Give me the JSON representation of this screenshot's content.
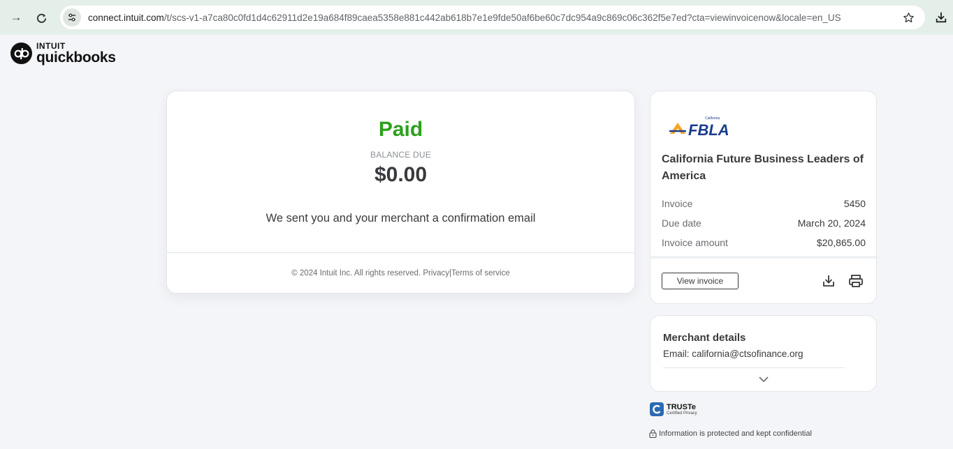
{
  "browser": {
    "url_host": "connect.intuit.com",
    "url_rest": "/t/scs-v1-a7ca80c0fd1d4c62911d2e19a684f89caea5358e881c442ab618b7e1e9fde50af6be60c7dc954a9c869c06c362f5e7ed?cta=viewinvoicenow&locale=en_US"
  },
  "logo": {
    "brand": "INTUIT",
    "product": "quickbooks"
  },
  "status": {
    "title": "Paid",
    "balance_label": "BALANCE DUE",
    "balance_amount": "$0.00",
    "confirmation": "We sent you and your merchant a confirmation email"
  },
  "footer": {
    "copyright": "© 2024 Intuit Inc. All rights reserved.",
    "privacy": "Privacy",
    "separator": "|",
    "terms": "Terms of service"
  },
  "invoice": {
    "logo_state": "California",
    "logo_name": "FBLA",
    "org_name": "California Future Business Leaders of America",
    "rows": [
      {
        "label": "Invoice",
        "value": "5450"
      },
      {
        "label": "Due date",
        "value": "March 20, 2024"
      },
      {
        "label": "Invoice amount",
        "value": "$20,865.00"
      }
    ],
    "view_button": "View invoice"
  },
  "merchant": {
    "title": "Merchant details",
    "email": "Email: california@ctsofinance.org"
  },
  "trust": {
    "badge_name": "TRUSTe",
    "badge_sub": "Certified Privacy",
    "notice": "Information is protected and kept confidential"
  },
  "colors": {
    "paid_green": "#2ca01c",
    "chrome_bg": "#e4efe9",
    "page_bg": "#f4f5f8"
  }
}
